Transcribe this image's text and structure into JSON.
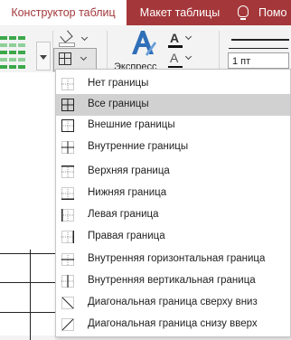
{
  "tabs": [
    {
      "label": "Конструктор таблиц",
      "selected": true
    },
    {
      "label": "Макет таблицы",
      "selected": false
    },
    {
      "label": "Помо",
      "selected": false
    }
  ],
  "ribbon": {
    "express_label": "Экспресс",
    "line_weight": "1 пт"
  },
  "menu": {
    "items": [
      {
        "label": "Нет границы",
        "icon": "no-border-icon"
      },
      {
        "label": "Все границы",
        "icon": "all-borders-icon",
        "selected": true
      },
      {
        "label": "Внешние границы",
        "icon": "outside-borders-icon"
      },
      {
        "label": "Внутренние границы",
        "icon": "inside-borders-icon"
      },
      {
        "label": "Верхняя граница",
        "icon": "top-border-icon"
      },
      {
        "label": "Нижняя граница",
        "icon": "bottom-border-icon"
      },
      {
        "label": "Левая граница",
        "icon": "left-border-icon"
      },
      {
        "label": "Правая граница",
        "icon": "right-border-icon"
      },
      {
        "label": "Внутренняя горизонтальная граница",
        "icon": "inside-horizontal-border-icon"
      },
      {
        "label": "Внутренняя вертикальная граница",
        "icon": "inside-vertical-border-icon"
      },
      {
        "label": "Диагональная граница сверху вниз",
        "icon": "diagonal-down-border-icon"
      },
      {
        "label": "Диагональная граница снизу вверх",
        "icon": "diagonal-up-border-icon"
      }
    ]
  },
  "colors": {
    "tab_bar": "#a4373a",
    "menu_selection": "#d1d1d1",
    "table_style_green": "#3ca84a"
  }
}
